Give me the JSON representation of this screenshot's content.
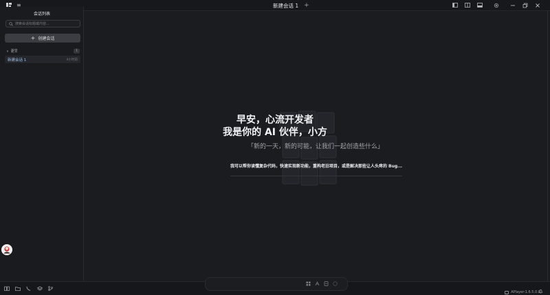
{
  "window": {
    "tab_title": "新建会话 1",
    "tab_add": "+",
    "menu_glyph": "≡"
  },
  "sidebar": {
    "title": "会话列表",
    "search_placeholder": "搜索会话标题或内容...",
    "create_button": "创建会话",
    "create_plus": "+",
    "group": {
      "chevron": "∨",
      "label": "更早",
      "count": "1"
    },
    "sessions": [
      {
        "name": "新建会话 1",
        "time": "4小时前"
      }
    ]
  },
  "main": {
    "greeting_line1": "早安，心流开发者",
    "greeting_line2": "我是你的 AI 伙伴，小方",
    "quote": "「新的一天，新的可能，让我们一起创造些什么」",
    "description": "我可以帮你读懂复杂代码，快速实现新功能，重构老旧项目，或是解决那些让人头疼的 Bug..."
  },
  "status": {
    "version": "APlayer-1.6.5.0.0"
  },
  "icons": {
    "app_logo": "logo-icon",
    "menu": "menu-icon",
    "layout_left": "sidebar-left-icon",
    "layout_split": "split-view-icon",
    "layout_right": "sidebar-right-icon",
    "settings": "gear-icon",
    "minimize": "minimize-icon",
    "restore": "restore-icon",
    "close": "close-icon",
    "search": "search-icon",
    "bell": "bell-icon"
  },
  "colors": {
    "background": "#1b1c20",
    "accent_text": "#9cc0e6",
    "button_bg": "#3b3d42"
  }
}
